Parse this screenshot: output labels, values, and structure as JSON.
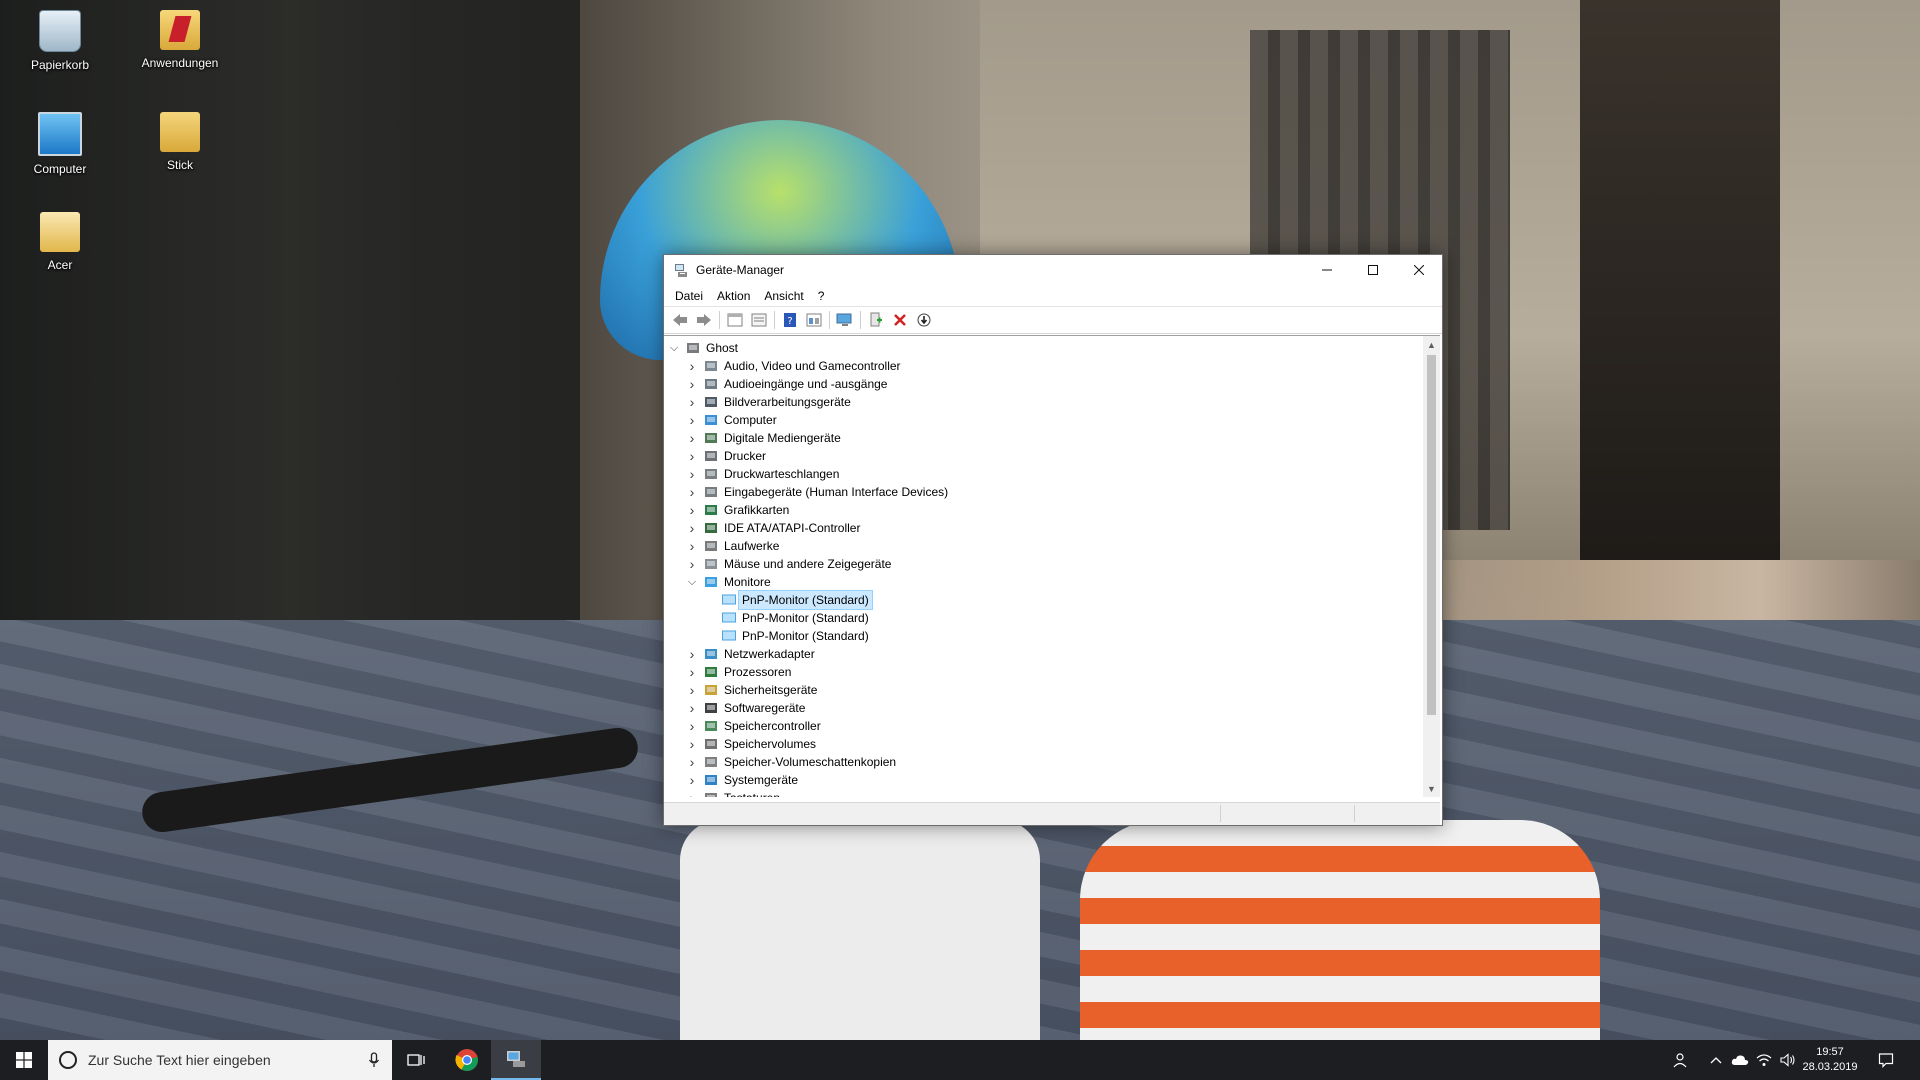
{
  "desktop": {
    "icons": [
      {
        "label": "Papierkorb"
      },
      {
        "label": "Anwendungen"
      },
      {
        "label": "Computer"
      },
      {
        "label": "Stick"
      },
      {
        "label": "Acer"
      }
    ]
  },
  "window": {
    "title": "Geräte-Manager",
    "controls": {
      "minimize": "—",
      "maximize": "☐",
      "close": "✕"
    },
    "menu": [
      "Datei",
      "Aktion",
      "Ansicht",
      "?"
    ],
    "toolbar_icons": [
      "back-icon",
      "forward-icon",
      "properties-icon",
      "view-icon",
      "help-icon",
      "update-driver-icon",
      "scan-hardware-icon",
      "add-driver-icon",
      "uninstall-icon",
      "download-icon"
    ],
    "tree": {
      "root": "Ghost",
      "categories": [
        {
          "label": "Audio, Video und Gamecontroller",
          "expanded": false,
          "icon": "audio-icon"
        },
        {
          "label": "Audioeingänge und -ausgänge",
          "expanded": false,
          "icon": "speaker-icon"
        },
        {
          "label": "Bildverarbeitungsgeräte",
          "expanded": false,
          "icon": "camera-icon"
        },
        {
          "label": "Computer",
          "expanded": false,
          "icon": "computer-icon"
        },
        {
          "label": "Digitale Mediengeräte",
          "expanded": false,
          "icon": "media-device-icon"
        },
        {
          "label": "Drucker",
          "expanded": false,
          "icon": "printer-icon"
        },
        {
          "label": "Druckwarteschlangen",
          "expanded": false,
          "icon": "print-queue-icon"
        },
        {
          "label": "Eingabegeräte (Human Interface Devices)",
          "expanded": false,
          "icon": "hid-icon"
        },
        {
          "label": "Grafikkarten",
          "expanded": false,
          "icon": "display-adapter-icon"
        },
        {
          "label": "IDE ATA/ATAPI-Controller",
          "expanded": false,
          "icon": "ide-controller-icon"
        },
        {
          "label": "Laufwerke",
          "expanded": false,
          "icon": "drive-icon"
        },
        {
          "label": "Mäuse und andere Zeigegeräte",
          "expanded": false,
          "icon": "mouse-icon"
        },
        {
          "label": "Monitore",
          "expanded": true,
          "icon": "monitor-icon",
          "children": [
            {
              "label": "PnP-Monitor (Standard)",
              "selected": true
            },
            {
              "label": "PnP-Monitor (Standard)",
              "selected": false
            },
            {
              "label": "PnP-Monitor (Standard)",
              "selected": false
            }
          ]
        },
        {
          "label": "Netzwerkadapter",
          "expanded": false,
          "icon": "network-adapter-icon"
        },
        {
          "label": "Prozessoren",
          "expanded": false,
          "icon": "processor-icon"
        },
        {
          "label": "Sicherheitsgeräte",
          "expanded": false,
          "icon": "security-device-icon"
        },
        {
          "label": "Softwaregeräte",
          "expanded": false,
          "icon": "software-device-icon"
        },
        {
          "label": "Speichercontroller",
          "expanded": false,
          "icon": "storage-controller-icon"
        },
        {
          "label": "Speichervolumes",
          "expanded": false,
          "icon": "storage-volume-icon"
        },
        {
          "label": "Speicher-Volumeschattenkopien",
          "expanded": false,
          "icon": "shadow-copy-icon"
        },
        {
          "label": "Systemgeräte",
          "expanded": false,
          "icon": "system-device-icon"
        },
        {
          "label": "Tastaturen",
          "expanded": false,
          "icon": "keyboard-icon"
        }
      ]
    }
  },
  "taskbar": {
    "search_placeholder": "Zur Suche Text hier eingeben",
    "clock": {
      "time": "19:57",
      "date": "28.03.2019"
    },
    "colors": {
      "background": "#1c1e22",
      "accent": "#0078d7"
    }
  }
}
